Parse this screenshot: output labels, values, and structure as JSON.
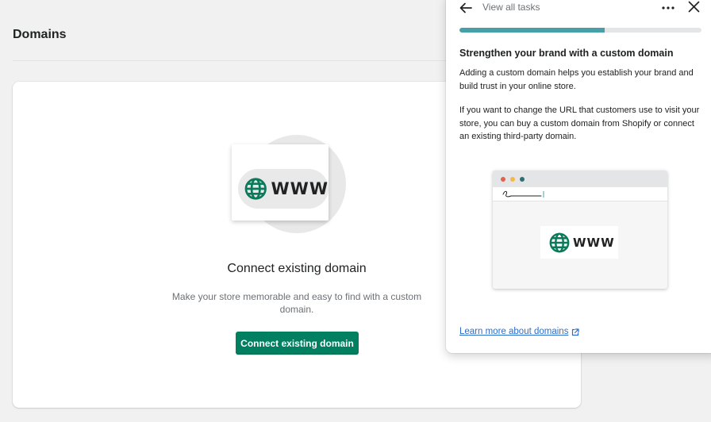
{
  "page": {
    "title": "Domains"
  },
  "empty_state": {
    "illustration_text": "WWW",
    "heading": "Connect existing domain",
    "description": "Make your store memorable and easy to find with a custom domain.",
    "button_label": "Connect existing domain"
  },
  "side_panel": {
    "back_label": "View all tasks",
    "progress_percent": 60,
    "heading": "Strengthen your brand with a custom domain",
    "paragraph_1": "Adding a custom domain helps you establish your brand and build trust in your online store.",
    "paragraph_2": "If you want to change the URL that customers use to visit your store, you can buy a custom domain from Shopify or connect an existing third-party domain.",
    "illustration_text": "WWW",
    "learn_more_link": "Learn more about domains"
  },
  "colors": {
    "primary": "#008060",
    "progress": "#47a0a8",
    "link": "#2c6ecb",
    "globe": "#0b7a5a"
  },
  "icons": [
    "arrow-left-icon",
    "more-horizontal-icon",
    "close-icon",
    "globe-icon",
    "external-link-icon"
  ]
}
